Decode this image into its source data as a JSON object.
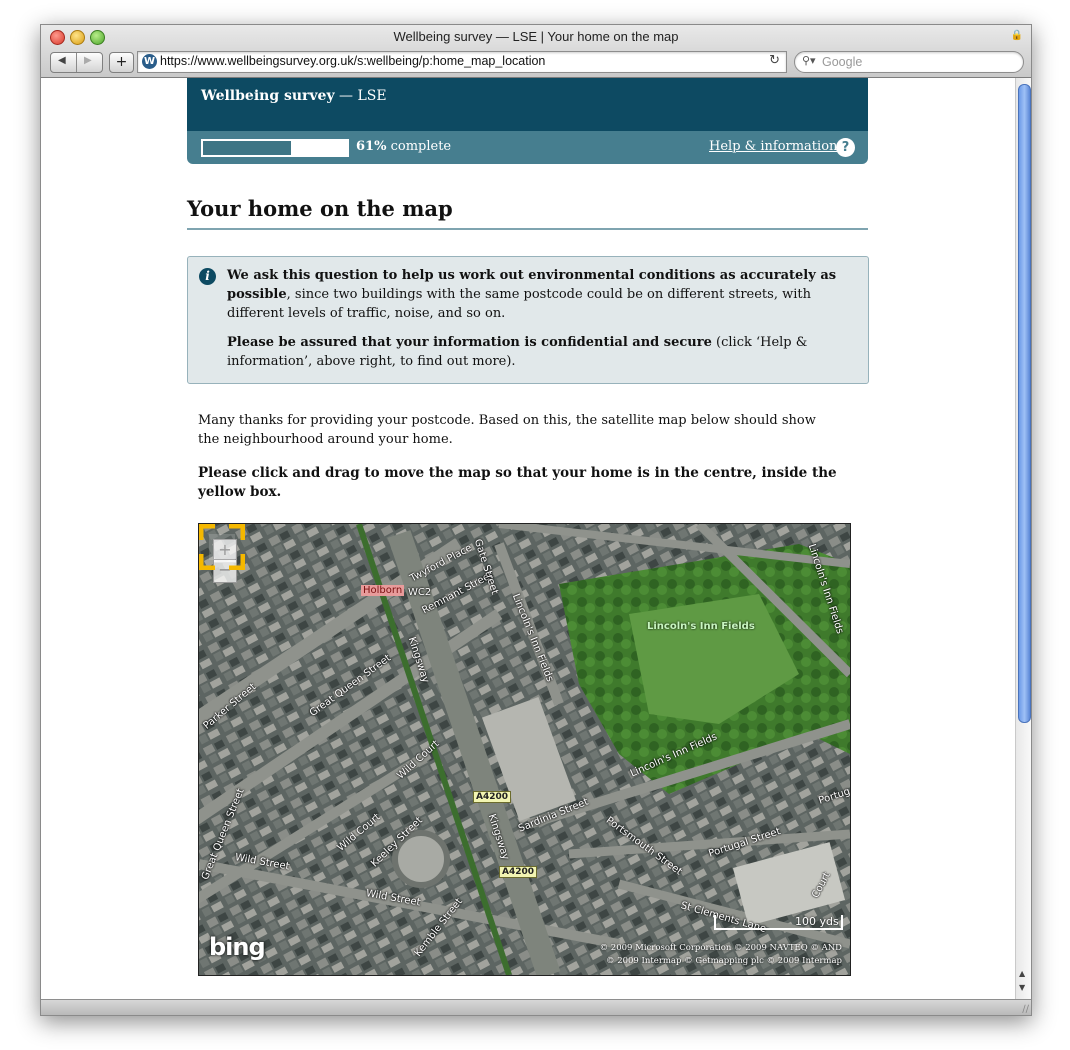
{
  "browser": {
    "window_title": "Wellbeing survey — LSE | Your home on the map",
    "url": "https://www.wellbeingsurvey.org.uk/s:wellbeing/p:home_map_location",
    "search_placeholder": "Google",
    "back_icon": "triangle-left",
    "forward_icon": "triangle-right",
    "add_bookmark_label": "+",
    "favicon_letter": "W",
    "reload_icon": "↻"
  },
  "header": {
    "brand_bold": "Wellbeing survey",
    "brand_rest": " — LSE",
    "progress_percent": 61,
    "progress_value": "61%",
    "progress_suffix": " complete",
    "help_link": "Help & information",
    "help_icon": "?"
  },
  "page": {
    "title": "Your home on the map",
    "info_bold_1": "We ask this question to help us work out environmental conditions as accurately as possible",
    "info_rest_1": ", since two buildings with the same postcode could be on different streets, with different levels of traffic, noise, and so on.",
    "info_bold_2": "Please be assured that your information is confidential and secure",
    "info_rest_2": " (click ‘Help & information’, above right, to find out more).",
    "intro": "Many thanks for providing your postcode. Based on this, the satellite map below should show the neighbourhood around your home.",
    "instruction": "Please click and drag to move the map so that your home is in the centre, inside the yellow box."
  },
  "map": {
    "zoom_in": "+",
    "zoom_out": "−",
    "labels": {
      "holborn": "Holborn",
      "wc2": "WC2",
      "twyford_place": "Twyford Place",
      "remnant_street": "Remnant Street",
      "gate_street": "Gate Street",
      "lincolns_inn_fields_n": "Lincoln's Inn Fields",
      "lincolns_inn_fields_park": "Lincoln's Inn Fields",
      "lincolns_inn_fields_s": "Lincoln's Inn Fields",
      "lincolns_in_fields_e": "Lincoln's Inn Fields",
      "kingsway_n": "Kingsway",
      "kingsway_s": "Kingsway",
      "parker_street": "Parker Street",
      "great_queen_street": "Great Queen Street",
      "great_queen_street_w": "Great Queen Street",
      "wild_court": "Wild Court",
      "wild_court_2": "Wild Court",
      "wild_street": "Wild Street",
      "wild_street_2": "Wild Street",
      "keeley_street": "Keeley Street",
      "kemble_street": "Kemble Street",
      "sardinia_street": "Sardinia Street",
      "portsmouth_street": "Portsmouth Street",
      "portugal_street": "Portugal Street",
      "portugal_edge": "Portug",
      "st_clements_lane": "St Clements Lane",
      "serle_court": "Court",
      "a4200_1": "A4200",
      "a4200_2": "A4200"
    },
    "scale_label": "100 yds",
    "copyright_1": "© 2009 Microsoft Corporation   © 2009 NAVTEQ   © AND",
    "copyright_2": "© 2009 Intermap   © Getmapping plc   © 2009 Intermap",
    "logo": "bing"
  },
  "colors": {
    "header": "#0d4a62",
    "progress_bar": "#467e8f",
    "info_box": "#e1e8ea",
    "marker": "#f5b800"
  }
}
